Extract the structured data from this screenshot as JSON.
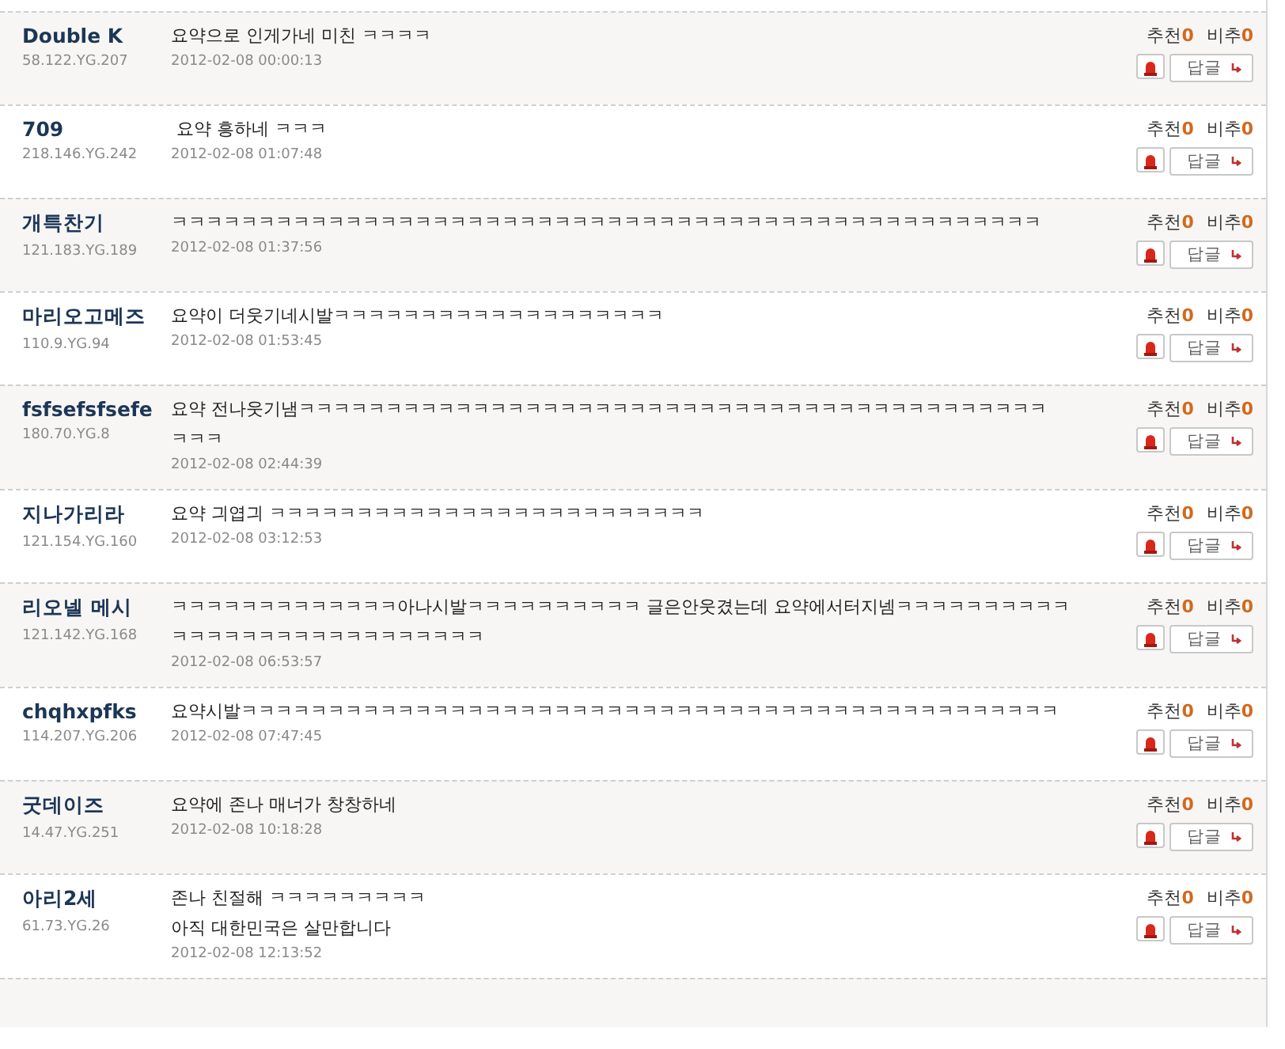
{
  "comments": [
    {
      "name": "Double K",
      "ip": "58.122.YG.207",
      "lines": [
        "요약으로 인게가네 미친 ㅋㅋㅋㅋ"
      ],
      "date": "2012-02-08 00:00:13",
      "up_label": "추천",
      "up": "0",
      "down_label": "비추",
      "down": "0",
      "reply": "답글"
    },
    {
      "name": "709",
      "ip": "218.146.YG.242",
      "lines": [
        " 요약 흥하네 ㅋㅋㅋ"
      ],
      "date": "2012-02-08 01:07:48",
      "up_label": "추천",
      "up": "0",
      "down_label": "비추",
      "down": "0",
      "reply": "답글"
    },
    {
      "name": "개특찬기",
      "ip": "121.183.YG.189",
      "lines": [
        "ㅋㅋㅋㅋㅋㅋㅋㅋㅋㅋㅋㅋㅋㅋㅋㅋㅋㅋㅋㅋㅋㅋㅋㅋㅋㅋㅋㅋㅋㅋㅋㅋㅋㅋㅋㅋㅋㅋㅋㅋㅋㅋㅋㅋㅋㅋㅋㅋㅋㅋ"
      ],
      "date": "2012-02-08 01:37:56",
      "up_label": "추천",
      "up": "0",
      "down_label": "비추",
      "down": "0",
      "reply": "답글"
    },
    {
      "name": "마리오고메즈",
      "ip": "110.9.YG.94",
      "lines": [
        "요약이 더웃기네시발ㅋㅋㅋㅋㅋㅋㅋㅋㅋㅋㅋㅋㅋㅋㅋㅋㅋㅋㅋ"
      ],
      "date": "2012-02-08 01:53:45",
      "up_label": "추천",
      "up": "0",
      "down_label": "비추",
      "down": "0",
      "reply": "답글"
    },
    {
      "name": "fsfsefsfsefe",
      "ip": "180.70.YG.8",
      "lines": [
        "요약 전나웃기냄ㅋㅋㅋㅋㅋㅋㅋㅋㅋㅋㅋㅋㅋㅋㅋㅋㅋㅋㅋㅋㅋㅋㅋㅋㅋㅋㅋㅋㅋㅋㅋㅋㅋㅋㅋㅋㅋㅋㅋㅋㅋㅋㅋ",
        "ㅋㅋㅋ"
      ],
      "date": "2012-02-08 02:44:39",
      "up_label": "추천",
      "up": "0",
      "down_label": "비추",
      "down": "0",
      "reply": "답글"
    },
    {
      "name": "지나가리라",
      "ip": "121.154.YG.160",
      "lines": [
        "요약 긔엽긔 ㅋㅋㅋㅋㅋㅋㅋㅋㅋㅋㅋㅋㅋㅋㅋㅋㅋㅋㅋㅋㅋㅋㅋㅋㅋ"
      ],
      "date": "2012-02-08 03:12:53",
      "up_label": "추천",
      "up": "0",
      "down_label": "비추",
      "down": "0",
      "reply": "답글"
    },
    {
      "name": "리오넬 메시",
      "ip": "121.142.YG.168",
      "lines": [
        "ㅋㅋㅋㅋㅋㅋㅋㅋㅋㅋㅋㅋㅋ아나시발ㅋㅋㅋㅋㅋㅋㅋㅋㅋㅋ 글은안웃겼는데 요약에서터지넴ㅋㅋㅋㅋㅋㅋㅋㅋㅋㅋ",
        "ㅋㅋㅋㅋㅋㅋㅋㅋㅋㅋㅋㅋㅋㅋㅋㅋㅋㅋ"
      ],
      "date": "2012-02-08 06:53:57",
      "up_label": "추천",
      "up": "0",
      "down_label": "비추",
      "down": "0",
      "reply": "답글"
    },
    {
      "name": "chqhxpfks",
      "ip": "114.207.YG.206",
      "lines": [
        "요약시발ㅋㅋㅋㅋㅋㅋㅋㅋㅋㅋㅋㅋㅋㅋㅋㅋㅋㅋㅋㅋㅋㅋㅋㅋㅋㅋㅋㅋㅋㅋㅋㅋㅋㅋㅋㅋㅋㅋㅋㅋㅋㅋㅋㅋㅋㅋㅋ"
      ],
      "date": "2012-02-08 07:47:45",
      "up_label": "추천",
      "up": "0",
      "down_label": "비추",
      "down": "0",
      "reply": "답글"
    },
    {
      "name": "굿데이즈",
      "ip": "14.47.YG.251",
      "lines": [
        "요약에 존나 매너가 창창하네"
      ],
      "date": "2012-02-08 10:18:28",
      "up_label": "추천",
      "up": "0",
      "down_label": "비추",
      "down": "0",
      "reply": "답글"
    },
    {
      "name": "아리2세",
      "ip": "61.73.YG.26",
      "lines": [
        "존나 친절해 ㅋㅋㅋㅋㅋㅋㅋㅋㅋ",
        "아직 대한민국은 살만합니다"
      ],
      "date": "2012-02-08 12:13:52",
      "up_label": "추천",
      "up": "0",
      "down_label": "비추",
      "down": "0",
      "reply": "답글"
    }
  ]
}
